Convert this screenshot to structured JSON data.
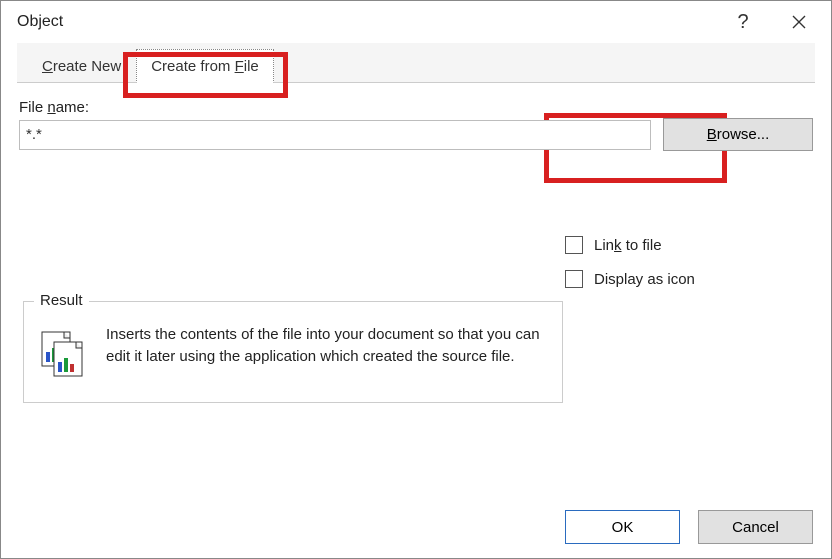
{
  "titlebar": {
    "title": "Object"
  },
  "tabs": {
    "create_new": "Create New",
    "create_from_file": "Create from File"
  },
  "file": {
    "label": "File name:",
    "value": "*.*",
    "browse": "Browse..."
  },
  "checks": {
    "link": "Link to file",
    "display_icon": "Display as icon"
  },
  "result": {
    "legend": "Result",
    "text": "Inserts the contents of the file into your document so that you can edit it later using the application which created the source file."
  },
  "buttons": {
    "ok": "OK",
    "cancel": "Cancel"
  }
}
